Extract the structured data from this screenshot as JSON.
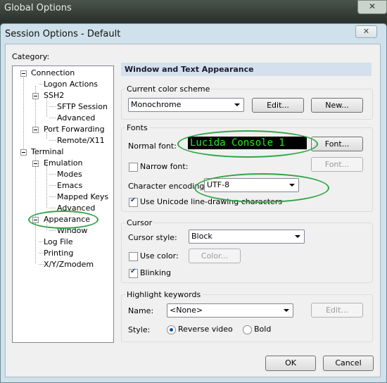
{
  "background_window": {
    "title": "Global Options",
    "close_glyph": "✕"
  },
  "dialog": {
    "title": "Session Options - Default",
    "close_glyph": "✕"
  },
  "category": {
    "label": "Category:",
    "items": [
      "Connection",
      "Logon Actions",
      "SSH2",
      "SFTP Session",
      "Advanced",
      "Port Forwarding",
      "Remote/X11",
      "Terminal",
      "Emulation",
      "Modes",
      "Emacs",
      "Mapped Keys",
      "Advanced",
      "Appearance",
      "Window",
      "Log File",
      "Printing",
      "X/Y/Zmodem"
    ]
  },
  "panel": {
    "title": "Window and Text Appearance"
  },
  "color_scheme": {
    "group_title": "Current color scheme",
    "value": "Monochrome",
    "edit_label": "Edit...",
    "new_label": "New..."
  },
  "fonts": {
    "group_title": "Fonts",
    "normal_font_label": "Normal font:",
    "normal_font_value": "Lucida Console 1",
    "font_button": "Font...",
    "narrow_font_label": "Narrow font:",
    "narrow_font_button": "Font...",
    "encoding_label": "Character encoding:",
    "encoding_value": "UTF-8",
    "unicode_label": "Use Unicode line-drawing characters"
  },
  "cursor": {
    "group_title": "Cursor",
    "style_label": "Cursor style:",
    "style_value": "Block",
    "use_color_label": "Use color:",
    "color_button": "Color...",
    "blinking_label": "Blinking"
  },
  "highlight": {
    "group_title": "Highlight keywords",
    "name_label": "Name:",
    "name_value": "<None>",
    "edit_label": "Edit...",
    "style_label": "Style:",
    "reverse_label": "Reverse video",
    "bold_label": "Bold"
  },
  "footer": {
    "ok_label": "OK",
    "cancel_label": "Cancel"
  },
  "colors": {
    "annotation": "#2fa544",
    "font_preview_fg": "#27e627",
    "font_preview_bg": "#000000"
  }
}
